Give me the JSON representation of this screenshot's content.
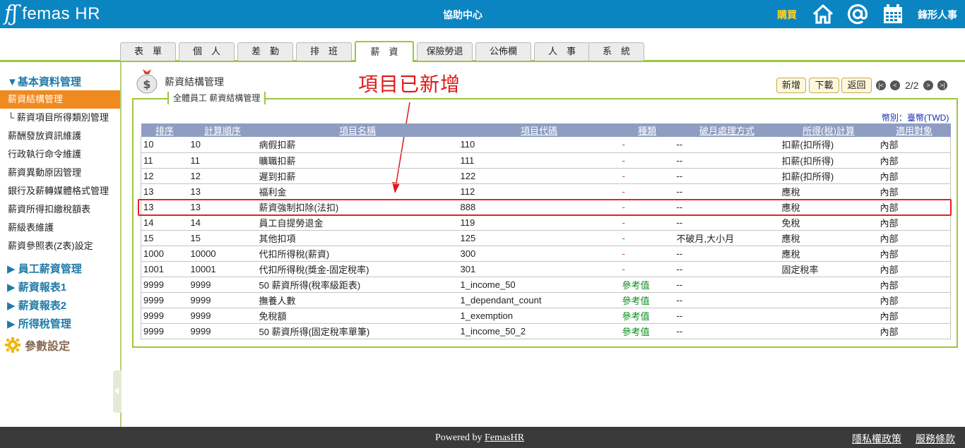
{
  "header": {
    "logo_mark": "fʃ",
    "logo_text": "femas HR",
    "center_title": "協助中心",
    "buy_label": "購買",
    "brand": "鋒形人事",
    "icons": [
      "home-icon",
      "at-icon",
      "calendar-icon"
    ]
  },
  "tabs": [
    {
      "label": "表　單"
    },
    {
      "label": "個　人"
    },
    {
      "label": "差　勤"
    },
    {
      "label": "排　班"
    },
    {
      "label": "薪　資",
      "active": true
    },
    {
      "label": "保險勞退"
    },
    {
      "label": "公佈欄"
    },
    {
      "label": "人　事"
    },
    {
      "label": "系　統"
    }
  ],
  "sidebar": {
    "groups": [
      {
        "label": "▼基本資料管理"
      },
      {
        "label": "▶ 員工薪資管理"
      },
      {
        "label": "▶ 薪資報表1"
      },
      {
        "label": "▶ 薪資報表2"
      },
      {
        "label": "▶ 所得稅管理"
      }
    ],
    "items": [
      {
        "label": "薪資結構管理",
        "active": true
      },
      {
        "label": "└ 薪資項目所得類別管理"
      },
      {
        "label": "薪酬發放資訊維護"
      },
      {
        "label": "行政執行命令維護"
      },
      {
        "label": "薪資異動原因管理"
      },
      {
        "label": "銀行及薪轉媒體格式管理"
      },
      {
        "label": "薪資所得扣繳稅額表"
      },
      {
        "label": "薪級表維護"
      },
      {
        "label": "薪資參照表(Z表)設定"
      }
    ],
    "params_label": "參數設定"
  },
  "main": {
    "page_title": "薪資結構管理",
    "legend": "全體員工 薪資結構管理",
    "buttons": {
      "add": "新增",
      "download": "下載",
      "back": "返回"
    },
    "pagination": {
      "text": "2/2",
      "first": "|<",
      "prev": "<",
      "next": ">",
      "last": ">|"
    },
    "currency_label": "幣別：臺幣(TWD)",
    "annotation": "項目已新增"
  },
  "table": {
    "headers": [
      "排序",
      "計算順序",
      "項目名稱",
      "項目代碼",
      "種類",
      "破月處理方式",
      "所得(稅)計算",
      "適用對象"
    ],
    "rows": [
      [
        "10",
        "10",
        "病假扣薪",
        "110",
        "-",
        "--",
        "扣薪(扣所得)",
        "內部"
      ],
      [
        "11",
        "11",
        "曠職扣薪",
        "111",
        "-",
        "--",
        "扣薪(扣所得)",
        "內部"
      ],
      [
        "12",
        "12",
        "遲到扣薪",
        "122",
        "-",
        "--",
        "扣薪(扣所得)",
        "內部"
      ],
      [
        "13",
        "13",
        "福利金",
        "112",
        "-",
        "--",
        "應稅",
        "內部"
      ],
      [
        "13",
        "13",
        "薪資強制扣除(法扣)",
        "888",
        "-",
        "--",
        "應稅",
        "內部"
      ],
      [
        "14",
        "14",
        "員工自提勞退金",
        "119",
        "-",
        "--",
        "免稅",
        "內部"
      ],
      [
        "15",
        "15",
        "其他扣項",
        "125",
        "-",
        "不破月,大小月",
        "應稅",
        "內部"
      ],
      [
        "1000",
        "10000",
        "代扣所得稅(薪資)",
        "300",
        "-",
        "--",
        "應稅",
        "內部"
      ],
      [
        "1001",
        "10001",
        "代扣所得稅(獎金-固定稅率)",
        "301",
        "-",
        "--",
        "固定稅率",
        "內部"
      ],
      [
        "9999",
        "9999",
        "50 薪資所得(稅率級距表)",
        "1_income_50",
        "參考值",
        "--",
        "",
        "內部"
      ],
      [
        "9999",
        "9999",
        "撫養人數",
        "1_dependant_count",
        "參考值",
        "--",
        "",
        "內部"
      ],
      [
        "9999",
        "9999",
        "免稅額",
        "1_exemption",
        "參考值",
        "--",
        "",
        "內部"
      ],
      [
        "9999",
        "9999",
        "50 薪資所得(固定稅率單筆)",
        "1_income_50_2",
        "參考值",
        "--",
        "",
        "內部"
      ]
    ],
    "highlight_row": 4
  },
  "footer": {
    "powered_prefix": "Powered by ",
    "powered_link": "FemasHR",
    "privacy": "隱私權政策",
    "terms": "服務條款"
  },
  "colors": {
    "header_bg": "#0b85c2",
    "accent_green": "#9dc73d",
    "active_orange": "#f08a1f",
    "table_header": "#8e9dc1",
    "annotation_red": "#e01818"
  }
}
